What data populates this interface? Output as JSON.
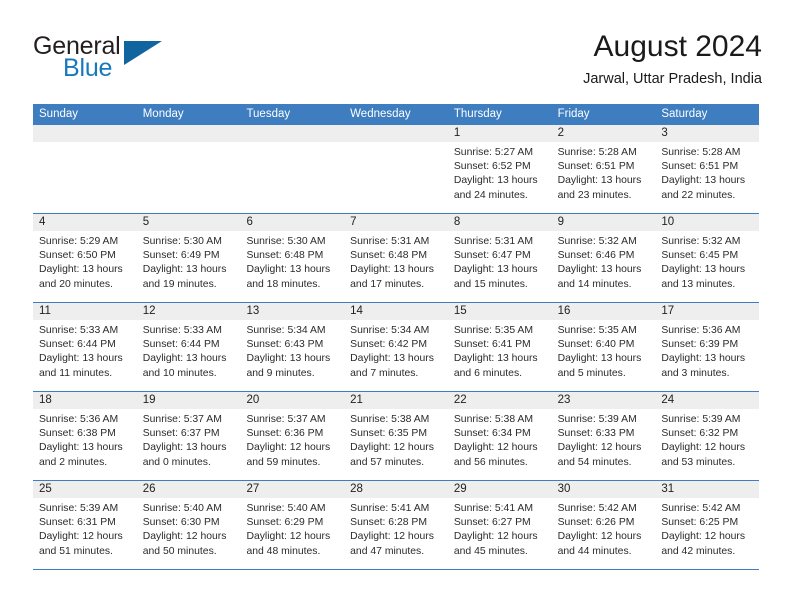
{
  "brand": {
    "line1": "General",
    "line2": "Blue",
    "logo_icon": "triangle-logo-icon",
    "accent_color": "#1878be"
  },
  "header": {
    "title": "August 2024",
    "location": "Jarwal, Uttar Pradesh, India"
  },
  "theme": {
    "header_blue": "#3d7dc0",
    "number_band": "#eeeeee",
    "text": "#2b2b2b"
  },
  "weekdays": [
    "Sunday",
    "Monday",
    "Tuesday",
    "Wednesday",
    "Thursday",
    "Friday",
    "Saturday"
  ],
  "labels": {
    "sunrise_prefix": "Sunrise:",
    "sunset_prefix": "Sunset:",
    "daylight_prefix": "Daylight:"
  },
  "weeks": [
    [
      {
        "day": "",
        "empty": true
      },
      {
        "day": "",
        "empty": true
      },
      {
        "day": "",
        "empty": true
      },
      {
        "day": "",
        "empty": true
      },
      {
        "day": "1",
        "sunrise": "Sunrise: 5:27 AM",
        "sunset": "Sunset: 6:52 PM",
        "daylight1": "Daylight: 13 hours",
        "daylight2": "and 24 minutes."
      },
      {
        "day": "2",
        "sunrise": "Sunrise: 5:28 AM",
        "sunset": "Sunset: 6:51 PM",
        "daylight1": "Daylight: 13 hours",
        "daylight2": "and 23 minutes."
      },
      {
        "day": "3",
        "sunrise": "Sunrise: 5:28 AM",
        "sunset": "Sunset: 6:51 PM",
        "daylight1": "Daylight: 13 hours",
        "daylight2": "and 22 minutes."
      }
    ],
    [
      {
        "day": "4",
        "sunrise": "Sunrise: 5:29 AM",
        "sunset": "Sunset: 6:50 PM",
        "daylight1": "Daylight: 13 hours",
        "daylight2": "and 20 minutes."
      },
      {
        "day": "5",
        "sunrise": "Sunrise: 5:30 AM",
        "sunset": "Sunset: 6:49 PM",
        "daylight1": "Daylight: 13 hours",
        "daylight2": "and 19 minutes."
      },
      {
        "day": "6",
        "sunrise": "Sunrise: 5:30 AM",
        "sunset": "Sunset: 6:48 PM",
        "daylight1": "Daylight: 13 hours",
        "daylight2": "and 18 minutes."
      },
      {
        "day": "7",
        "sunrise": "Sunrise: 5:31 AM",
        "sunset": "Sunset: 6:48 PM",
        "daylight1": "Daylight: 13 hours",
        "daylight2": "and 17 minutes."
      },
      {
        "day": "8",
        "sunrise": "Sunrise: 5:31 AM",
        "sunset": "Sunset: 6:47 PM",
        "daylight1": "Daylight: 13 hours",
        "daylight2": "and 15 minutes."
      },
      {
        "day": "9",
        "sunrise": "Sunrise: 5:32 AM",
        "sunset": "Sunset: 6:46 PM",
        "daylight1": "Daylight: 13 hours",
        "daylight2": "and 14 minutes."
      },
      {
        "day": "10",
        "sunrise": "Sunrise: 5:32 AM",
        "sunset": "Sunset: 6:45 PM",
        "daylight1": "Daylight: 13 hours",
        "daylight2": "and 13 minutes."
      }
    ],
    [
      {
        "day": "11",
        "sunrise": "Sunrise: 5:33 AM",
        "sunset": "Sunset: 6:44 PM",
        "daylight1": "Daylight: 13 hours",
        "daylight2": "and 11 minutes."
      },
      {
        "day": "12",
        "sunrise": "Sunrise: 5:33 AM",
        "sunset": "Sunset: 6:44 PM",
        "daylight1": "Daylight: 13 hours",
        "daylight2": "and 10 minutes."
      },
      {
        "day": "13",
        "sunrise": "Sunrise: 5:34 AM",
        "sunset": "Sunset: 6:43 PM",
        "daylight1": "Daylight: 13 hours",
        "daylight2": "and 9 minutes."
      },
      {
        "day": "14",
        "sunrise": "Sunrise: 5:34 AM",
        "sunset": "Sunset: 6:42 PM",
        "daylight1": "Daylight: 13 hours",
        "daylight2": "and 7 minutes."
      },
      {
        "day": "15",
        "sunrise": "Sunrise: 5:35 AM",
        "sunset": "Sunset: 6:41 PM",
        "daylight1": "Daylight: 13 hours",
        "daylight2": "and 6 minutes."
      },
      {
        "day": "16",
        "sunrise": "Sunrise: 5:35 AM",
        "sunset": "Sunset: 6:40 PM",
        "daylight1": "Daylight: 13 hours",
        "daylight2": "and 5 minutes."
      },
      {
        "day": "17",
        "sunrise": "Sunrise: 5:36 AM",
        "sunset": "Sunset: 6:39 PM",
        "daylight1": "Daylight: 13 hours",
        "daylight2": "and 3 minutes."
      }
    ],
    [
      {
        "day": "18",
        "sunrise": "Sunrise: 5:36 AM",
        "sunset": "Sunset: 6:38 PM",
        "daylight1": "Daylight: 13 hours",
        "daylight2": "and 2 minutes."
      },
      {
        "day": "19",
        "sunrise": "Sunrise: 5:37 AM",
        "sunset": "Sunset: 6:37 PM",
        "daylight1": "Daylight: 13 hours",
        "daylight2": "and 0 minutes."
      },
      {
        "day": "20",
        "sunrise": "Sunrise: 5:37 AM",
        "sunset": "Sunset: 6:36 PM",
        "daylight1": "Daylight: 12 hours",
        "daylight2": "and 59 minutes."
      },
      {
        "day": "21",
        "sunrise": "Sunrise: 5:38 AM",
        "sunset": "Sunset: 6:35 PM",
        "daylight1": "Daylight: 12 hours",
        "daylight2": "and 57 minutes."
      },
      {
        "day": "22",
        "sunrise": "Sunrise: 5:38 AM",
        "sunset": "Sunset: 6:34 PM",
        "daylight1": "Daylight: 12 hours",
        "daylight2": "and 56 minutes."
      },
      {
        "day": "23",
        "sunrise": "Sunrise: 5:39 AM",
        "sunset": "Sunset: 6:33 PM",
        "daylight1": "Daylight: 12 hours",
        "daylight2": "and 54 minutes."
      },
      {
        "day": "24",
        "sunrise": "Sunrise: 5:39 AM",
        "sunset": "Sunset: 6:32 PM",
        "daylight1": "Daylight: 12 hours",
        "daylight2": "and 53 minutes."
      }
    ],
    [
      {
        "day": "25",
        "sunrise": "Sunrise: 5:39 AM",
        "sunset": "Sunset: 6:31 PM",
        "daylight1": "Daylight: 12 hours",
        "daylight2": "and 51 minutes."
      },
      {
        "day": "26",
        "sunrise": "Sunrise: 5:40 AM",
        "sunset": "Sunset: 6:30 PM",
        "daylight1": "Daylight: 12 hours",
        "daylight2": "and 50 minutes."
      },
      {
        "day": "27",
        "sunrise": "Sunrise: 5:40 AM",
        "sunset": "Sunset: 6:29 PM",
        "daylight1": "Daylight: 12 hours",
        "daylight2": "and 48 minutes."
      },
      {
        "day": "28",
        "sunrise": "Sunrise: 5:41 AM",
        "sunset": "Sunset: 6:28 PM",
        "daylight1": "Daylight: 12 hours",
        "daylight2": "and 47 minutes."
      },
      {
        "day": "29",
        "sunrise": "Sunrise: 5:41 AM",
        "sunset": "Sunset: 6:27 PM",
        "daylight1": "Daylight: 12 hours",
        "daylight2": "and 45 minutes."
      },
      {
        "day": "30",
        "sunrise": "Sunrise: 5:42 AM",
        "sunset": "Sunset: 6:26 PM",
        "daylight1": "Daylight: 12 hours",
        "daylight2": "and 44 minutes."
      },
      {
        "day": "31",
        "sunrise": "Sunrise: 5:42 AM",
        "sunset": "Sunset: 6:25 PM",
        "daylight1": "Daylight: 12 hours",
        "daylight2": "and 42 minutes."
      }
    ]
  ]
}
